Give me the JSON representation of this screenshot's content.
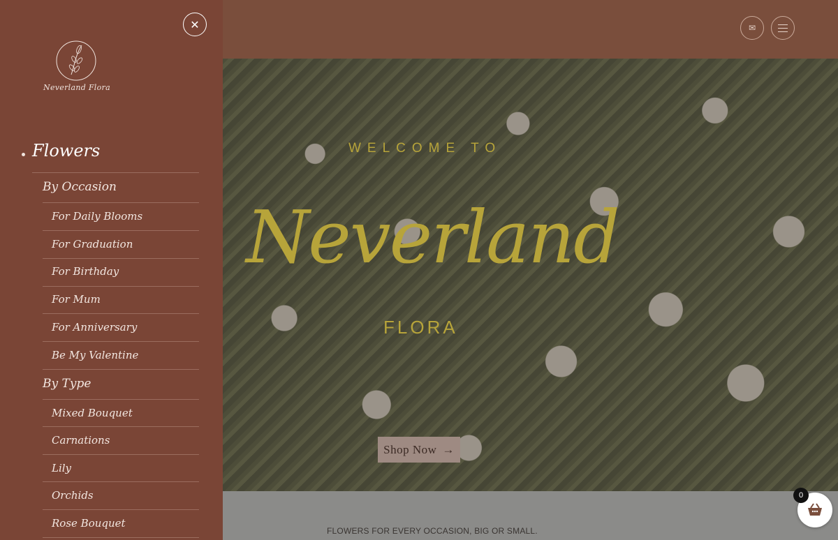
{
  "header": {
    "mail_icon": "✉",
    "menu_icon": "hamburger-menu"
  },
  "hero": {
    "eyebrow": "WELCOME TO",
    "title": "Neverland",
    "subtitle": "FLORA",
    "shop_label": "Shop Now",
    "shop_arrow": "→"
  },
  "below": {
    "tagline": "FLOWERS FOR EVERY OCCASION, BIG OR SMALL."
  },
  "cart": {
    "count": "0"
  },
  "sidebar": {
    "close_icon": "✕",
    "logo_text": "Neverland Flora",
    "top_item": "Flowers",
    "groups": [
      {
        "label": "By Occasion",
        "items": [
          "For Daily Blooms",
          "For Graduation",
          "For Birthday",
          "For Mum",
          "For Anniversary",
          "Be My Valentine"
        ]
      },
      {
        "label": "By Type",
        "items": [
          "Mixed Bouquet",
          "Carnations",
          "Lily",
          "Orchids",
          "Rose Bouquet"
        ]
      }
    ]
  },
  "colors": {
    "sidebar_bg": "#7a4536",
    "accent_gold": "#b7a43a",
    "header_bg": "#7a4e3c"
  }
}
